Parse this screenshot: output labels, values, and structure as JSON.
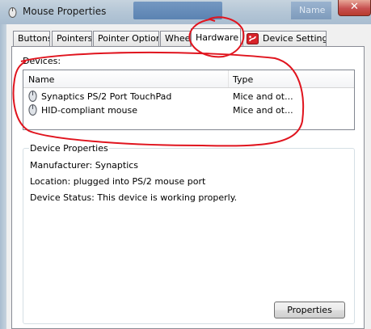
{
  "window": {
    "title": "Mouse Properties",
    "close_glyph": "✕",
    "background_text": "Name"
  },
  "tabs": [
    {
      "label": "Buttons"
    },
    {
      "label": "Pointers"
    },
    {
      "label": "Pointer Options"
    },
    {
      "label": "Whee"
    },
    {
      "label": "Hardware",
      "active": true
    },
    {
      "label": "Device Settings",
      "icon": "synaptics-icon"
    }
  ],
  "devices": {
    "label": "Devices:",
    "columns": {
      "name": "Name",
      "type": "Type"
    },
    "rows": [
      {
        "name": "Synaptics PS/2 Port TouchPad",
        "type": "Mice and ot...",
        "icon": "mouse-icon"
      },
      {
        "name": "HID-compliant mouse",
        "type": "Mice and ot...",
        "icon": "mouse-icon"
      }
    ]
  },
  "device_properties": {
    "title": "Device Properties",
    "manufacturer": "Manufacturer: Synaptics",
    "location": "Location: plugged into PS/2 mouse port",
    "status": "Device Status: This device is working properly.",
    "properties_button": "Properties"
  },
  "colors": {
    "annotation_red": "#e0141e",
    "titlebar": "#b4c6d6",
    "close_button": "#c75050"
  }
}
